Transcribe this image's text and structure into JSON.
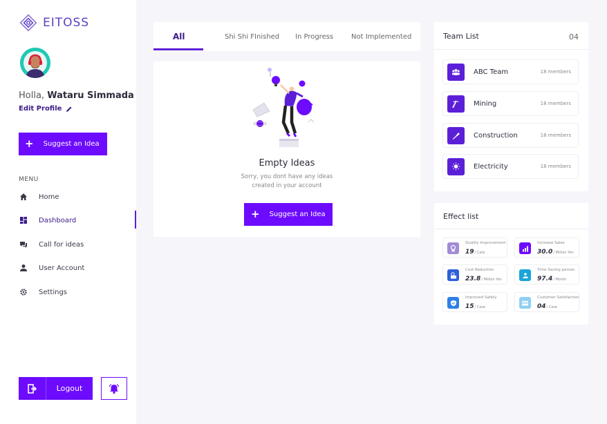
{
  "brand": {
    "name": "EITOSS"
  },
  "profile": {
    "greeting": "Holla,",
    "name": "Wataru Simmada",
    "edit_label": "Edit Profile"
  },
  "sidebar": {
    "suggest_label": "Suggest an Idea",
    "menu_label": "MENU",
    "items": [
      {
        "label": "Home",
        "icon": "home-icon"
      },
      {
        "label": "Dashboard",
        "icon": "dashboard-icon",
        "active": true
      },
      {
        "label": "Call for ideas",
        "icon": "chat-icon"
      },
      {
        "label": "User Account",
        "icon": "user-icon"
      },
      {
        "label": "Settings",
        "icon": "gear-icon"
      }
    ],
    "logout_label": "Logout"
  },
  "tabs": [
    {
      "label": "All",
      "active": true
    },
    {
      "label": "Shi Shi FInished"
    },
    {
      "label": "In Progress"
    },
    {
      "label": "Not Implemented"
    }
  ],
  "empty": {
    "title": "Empty Ideas",
    "line1": "Sorry, you dont have any ideas",
    "line2": "created in your account",
    "button_label": "Suggest an Idea"
  },
  "team": {
    "title": "Team List",
    "count": "04",
    "items": [
      {
        "name": "ABC Team",
        "members": "18 members",
        "icon": "group-icon"
      },
      {
        "name": "Mining",
        "members": "18 members",
        "icon": "pickaxe-icon"
      },
      {
        "name": "Construction",
        "members": "18 members",
        "icon": "trowel-icon"
      },
      {
        "name": "Electricity",
        "members": "18 members",
        "icon": "bulb-icon"
      }
    ]
  },
  "effects": {
    "title": "Effect list",
    "items": [
      {
        "label": "Quality Improvement",
        "value": "19",
        "unit": "/ Cate",
        "icon": "award-icon",
        "color": "#a18bd6"
      },
      {
        "label": "Increase Sales",
        "value": "30.0",
        "unit": "/ Million Yen",
        "icon": "chart-icon",
        "color": "#6d0bff"
      },
      {
        "label": "Cost Reduction",
        "value": "23.8",
        "unit": "/ Million Yen",
        "icon": "money-icon",
        "color": "#2f5fd8"
      },
      {
        "label": "Time Saving person",
        "value": "97.4",
        "unit": "/ Month",
        "icon": "hand-user-icon",
        "color": "#1aa5d9"
      },
      {
        "label": "Improved Safety",
        "value": "15",
        "unit": "/ Case",
        "icon": "shield-icon",
        "color": "#2f7fe8"
      },
      {
        "label": "Customer Satisfaction",
        "value": "04",
        "unit": "/ Case",
        "icon": "people-icon",
        "color": "#8fd0f2"
      }
    ]
  },
  "colors": {
    "accent": "#6d0bff",
    "brand_text": "#5b3fc4",
    "background": "#f6f5fa"
  }
}
